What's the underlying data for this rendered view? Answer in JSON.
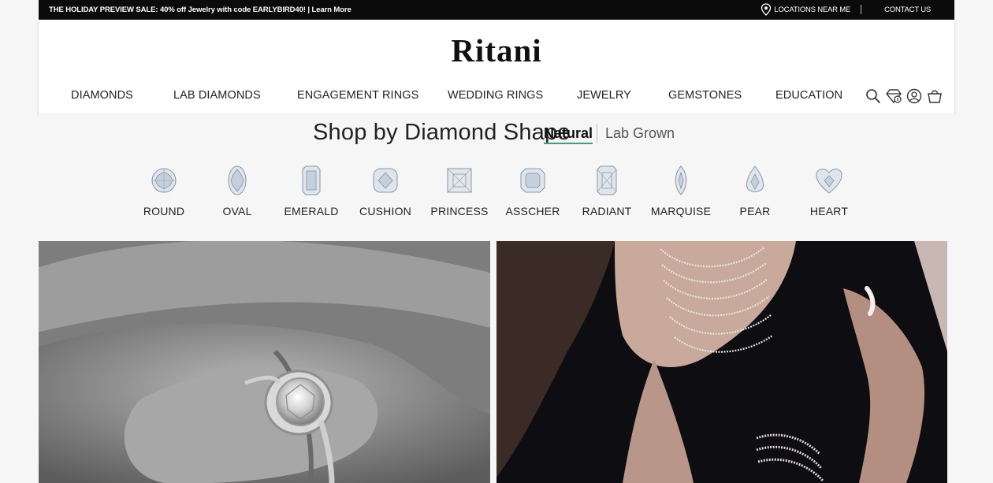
{
  "promo": {
    "text": "THE HOLIDAY PREVIEW SALE: 40% off Jewelry with code EARLYBIRD40! | Learn More",
    "locations": "LOCATIONS NEAR ME",
    "contact": "CONTACT US"
  },
  "brand": {
    "logo": "Ritani"
  },
  "nav": {
    "items": [
      {
        "label": "DIAMONDS"
      },
      {
        "label": "LAB DIAMONDS"
      },
      {
        "label": "ENGAGEMENT RINGS"
      },
      {
        "label": "WEDDING RINGS"
      },
      {
        "label": "JEWELRY"
      },
      {
        "label": "GEMSTONES"
      },
      {
        "label": "EDUCATION"
      }
    ],
    "icons": [
      "search-icon",
      "diamond-icon",
      "account-icon",
      "cart-icon"
    ]
  },
  "shapes_section": {
    "heading": "Shop by Diamond Shape",
    "toggle_natural": "Natural",
    "toggle_lab": "Lab Grown",
    "shapes": [
      {
        "label": "ROUND"
      },
      {
        "label": "OVAL"
      },
      {
        "label": "EMERALD"
      },
      {
        "label": "CUSHION"
      },
      {
        "label": "PRINCESS"
      },
      {
        "label": "ASSCHER"
      },
      {
        "label": "RADIANT"
      },
      {
        "label": "MARQUISE"
      },
      {
        "label": "PEAR"
      },
      {
        "label": "HEART"
      }
    ]
  },
  "colors": {
    "accent_underline": "#4a9a7a",
    "promo_bg": "#0b0b0b"
  }
}
